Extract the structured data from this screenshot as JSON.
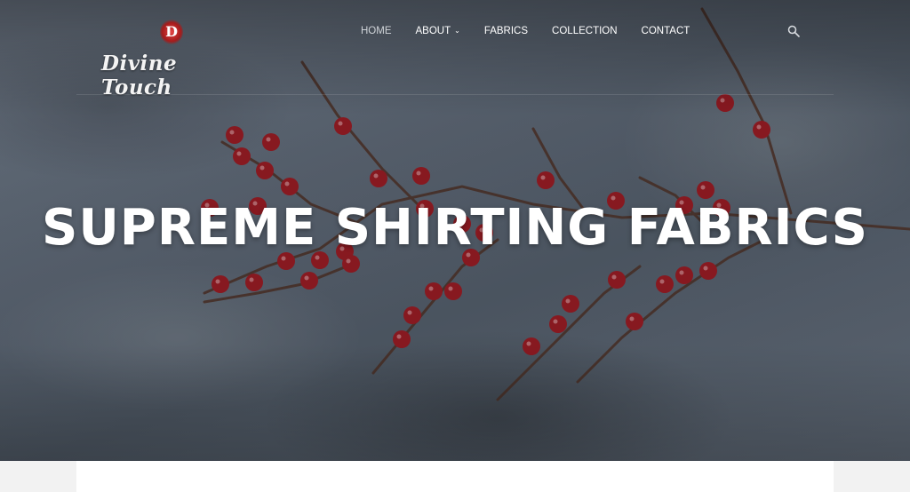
{
  "brand": {
    "logo_letter": "D",
    "name": "Divine Touch"
  },
  "nav": {
    "items": [
      {
        "label": "HOME",
        "active": true
      },
      {
        "label": "ABOUT",
        "has_dropdown": true
      },
      {
        "label": "FABRICS"
      },
      {
        "label": "COLLECTION"
      },
      {
        "label": "CONTACT"
      }
    ]
  },
  "hero": {
    "title": "SUPREME SHIRTING FABRICS"
  },
  "icons": {
    "search": "search-icon",
    "dropdown": "chevron-down-icon"
  },
  "colors": {
    "logo_red": "#c42a2a",
    "berry": "#8e1a22",
    "fabric": "#5a6470"
  }
}
